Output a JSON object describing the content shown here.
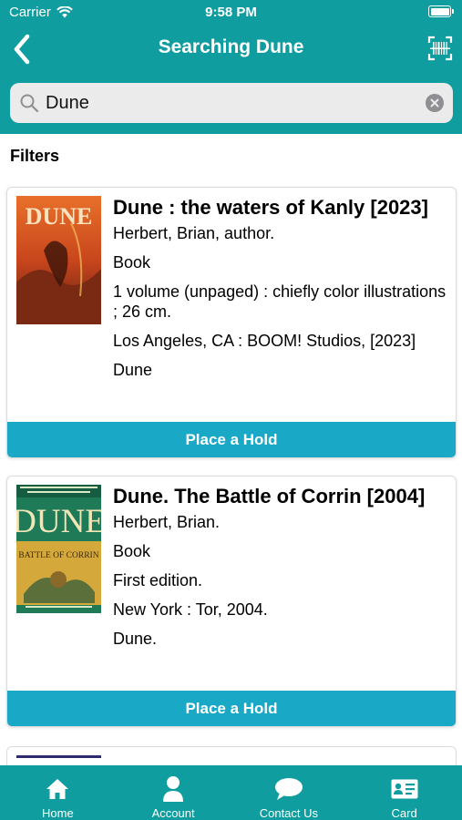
{
  "colors": {
    "teal": "#0f9d9f",
    "hold_button": "#19a9c7"
  },
  "status_bar": {
    "carrier": "Carrier",
    "time": "9:58 PM"
  },
  "nav": {
    "title": "Searching Dune",
    "back_icon": "chevron-left-icon",
    "scan_icon": "barcode-scan-icon"
  },
  "search": {
    "value": "Dune",
    "icon": "search-icon",
    "clear_icon": "clear-icon"
  },
  "filters_label": "Filters",
  "results": [
    {
      "title": "Dune : the waters of Kanly [2023]",
      "author": "Herbert, Brian, author.",
      "format": "Book",
      "description": "1 volume (unpaged) : chiefly color illustrations ; 26 cm.",
      "publisher": "Los Angeles, CA : BOOM! Studios, [2023]",
      "series": "Dune",
      "cover_text": "DUNE",
      "hold_label": "Place a Hold"
    },
    {
      "title": "Dune. The Battle of Corrin [2004]",
      "author": "Herbert, Brian.",
      "format": "Book",
      "edition": "First edition.",
      "publisher": "New York : Tor, 2004.",
      "series": "Dune.",
      "cover_text": "DUNE",
      "cover_subtitle": "BATTLE OF CORRIN",
      "hold_label": "Place a Hold"
    }
  ],
  "tabs": [
    {
      "label": "Home",
      "icon": "home-icon"
    },
    {
      "label": "Account",
      "icon": "account-icon"
    },
    {
      "label": "Contact Us",
      "icon": "chat-bubble-icon"
    },
    {
      "label": "Card",
      "icon": "library-card-icon"
    }
  ]
}
